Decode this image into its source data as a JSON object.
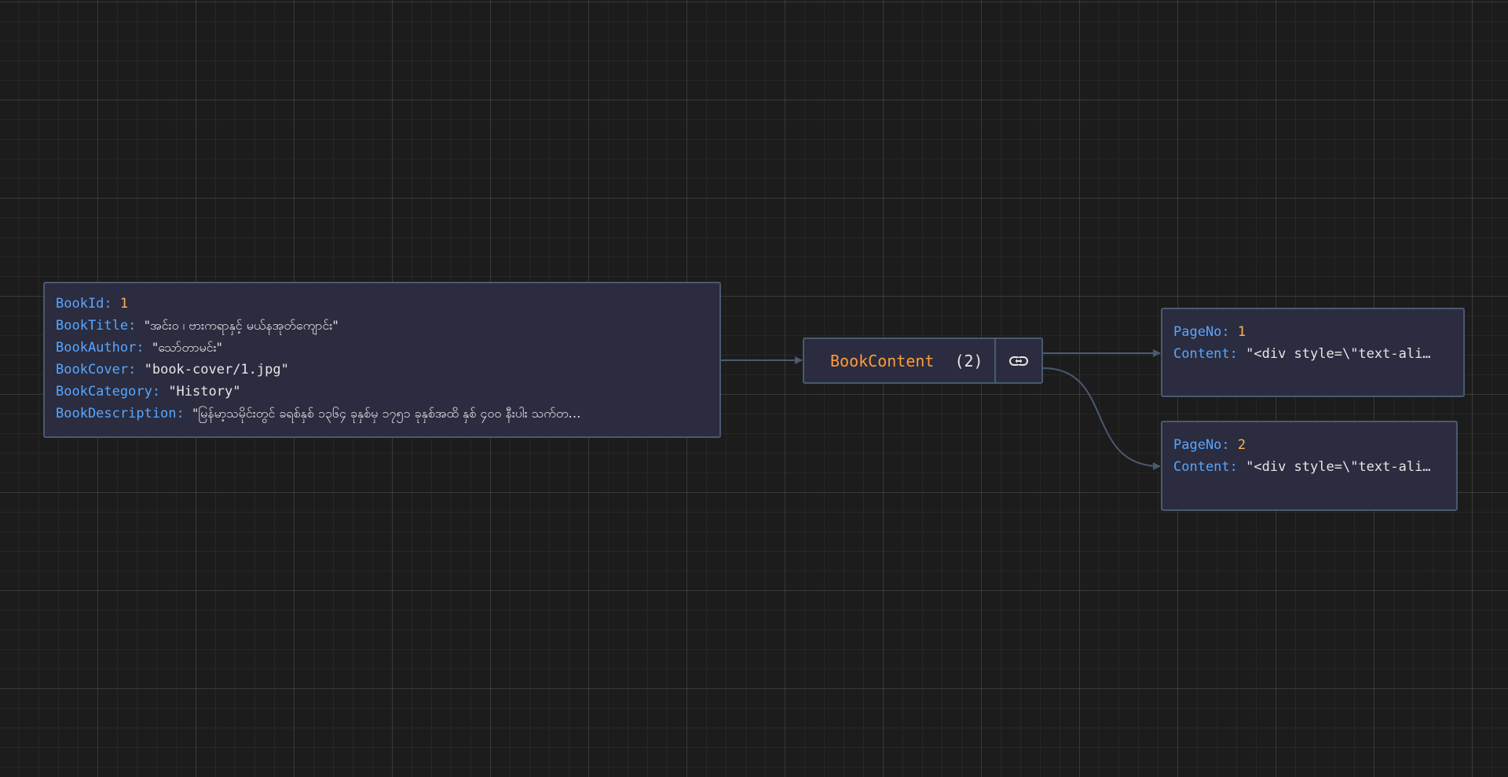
{
  "root_node": {
    "fields": [
      {
        "key": "BookId",
        "value": "1",
        "kind": "num"
      },
      {
        "key": "BookTitle",
        "value": "\"အင်းဝ ၊ ဗားကရာနှင့် မယ်နအုတ်ကျောင်း\"",
        "kind": "str"
      },
      {
        "key": "BookAuthor",
        "value": "\"သော်တာမင်း\"",
        "kind": "str"
      },
      {
        "key": "BookCover",
        "value": "\"book-cover/1.jpg\"",
        "kind": "str"
      },
      {
        "key": "BookCategory",
        "value": "\"History\"",
        "kind": "str"
      },
      {
        "key": "BookDescription",
        "value": "\"မြန်မာ့သမိုင်းတွင် ခရစ်နှစ် ၁၃၆၄ ခုနှစ်မှ ၁၇၅၁ ခုနှစ်အထိ နှစ် ၄၀၀ နီးပါး သက်တ…",
        "kind": "str"
      }
    ]
  },
  "array_node": {
    "title": "BookContent",
    "count": "(2)",
    "link_icon": "link-icon"
  },
  "child_nodes": [
    {
      "fields": [
        {
          "key": "PageNo",
          "value": "1",
          "kind": "num"
        },
        {
          "key": "Content",
          "value": "\"<div style=\\\"text-ali…",
          "kind": "str"
        }
      ]
    },
    {
      "fields": [
        {
          "key": "PageNo",
          "value": "2",
          "kind": "num"
        },
        {
          "key": "Content",
          "value": "\"<div style=\\\"text-ali…",
          "kind": "str"
        }
      ]
    }
  ],
  "colors": {
    "background": "#1c1c1d",
    "node_fill": "#2b2c3f",
    "node_border": "#495a70",
    "key": "#58a6ff",
    "number": "#ffb454",
    "string": "#e6e6e6",
    "array_title": "#ff9c3a",
    "edge": "#4a5a70"
  }
}
